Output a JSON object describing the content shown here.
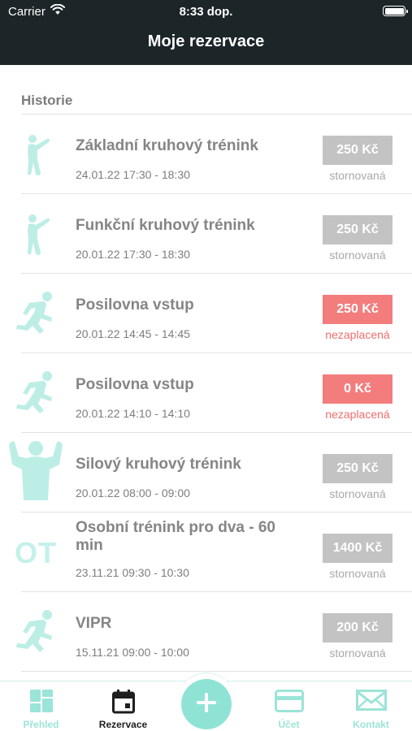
{
  "status_bar": {
    "carrier": "Carrier",
    "time": "8:33 dop."
  },
  "nav": {
    "title": "Moje rezervace"
  },
  "section": {
    "title": "Historie"
  },
  "colors": {
    "accent": "#8fe3d5",
    "header": "#1c2528",
    "paid_gray": "#c3c3c3",
    "unpaid_red": "#f37d7d"
  },
  "reservations": [
    {
      "icon": "stretching-person-icon",
      "title": "Základní kruhový trénink",
      "when": "24.01.22 17:30 - 18:30",
      "price": "250 Kč",
      "state": "stornovaná"
    },
    {
      "icon": "stretching-person-icon",
      "title": "Funkční kruhový trénink",
      "when": "20.01.22 17:30 - 18:30",
      "price": "250 Kč",
      "state": "stornovaná"
    },
    {
      "icon": "running-person-icon",
      "title": "Posilovna vstup",
      "when": "20.01.22 14:45 - 14:45",
      "price": "250 Kč",
      "state": "nezaplacená"
    },
    {
      "icon": "running-person-icon",
      "title": "Posilovna vstup",
      "when": "20.01.22 14:10 - 14:10",
      "price": "0 Kč",
      "state": "nezaplacená"
    },
    {
      "icon": "strongman-icon",
      "title": "Silový kruhový trénink",
      "when": "20.01.22 08:00 - 09:00",
      "price": "250 Kč",
      "state": "stornovaná"
    },
    {
      "icon_text": "OT",
      "title": "Osobní trénink pro dva - 60 min",
      "when": "23.11.21 09:30 - 10:30",
      "price": "1400 Kč",
      "state": "stornovaná"
    },
    {
      "icon": "running-person-icon",
      "title": "VIPR",
      "when": "15.11.21 09:00 - 10:00",
      "price": "200 Kč",
      "state": "stornovaná"
    }
  ],
  "tabbar": {
    "overview": {
      "label": "Přehled",
      "icon": "dashboard-icon"
    },
    "reservations": {
      "label": "Rezervace",
      "icon": "calendar-icon"
    },
    "add": {
      "icon": "plus-icon"
    },
    "account": {
      "label": "Účet",
      "icon": "credit-card-icon"
    },
    "contact": {
      "label": "Kontakt",
      "icon": "envelope-icon"
    }
  }
}
